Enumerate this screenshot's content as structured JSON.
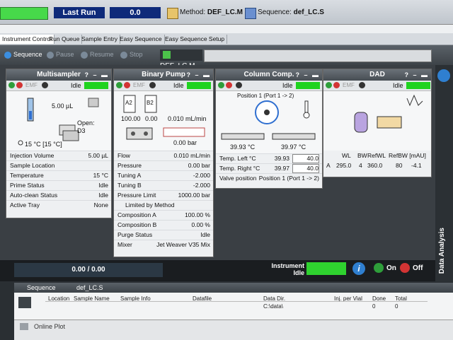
{
  "topbar": {
    "last_run_label": "Last Run",
    "run_value": "0.0",
    "method_label": "Method:",
    "method_name": "DEF_LC.M",
    "sequence_label": "Sequence:",
    "sequence_name": "def_LC.S"
  },
  "tabs": [
    {
      "label": "Instrument Control"
    },
    {
      "label": "Run Queue"
    },
    {
      "label": "Sample Entry"
    },
    {
      "label": "Easy Sequence"
    },
    {
      "label": "Easy Sequence Setup"
    }
  ],
  "toolbar": {
    "sequence": "Sequence",
    "pause": "Pause",
    "resume": "Resume",
    "stop": "Stop",
    "method_chip": "DEF_LC.M"
  },
  "modules": {
    "multisampler": {
      "title": "Multisampler",
      "status": "Idle",
      "volume": "5.00 µL",
      "open_label": "Open:",
      "open_pos": "D3",
      "temp": "15 °C [15 °C]",
      "params": [
        {
          "label": "Injection Volume",
          "value": "5.00 µL"
        },
        {
          "label": "Sample Location",
          "value": ""
        },
        {
          "label": "Temperature",
          "value": "15 °C"
        },
        {
          "label": "Prime Status",
          "value": "Idle"
        },
        {
          "label": "Auto-clean Status",
          "value": "Idle"
        },
        {
          "label": "Active Tray",
          "value": "None"
        }
      ]
    },
    "binary_pump": {
      "title": "Binary Pump",
      "status": "Idle",
      "bottle_a": "A2",
      "bottle_b": "B2",
      "val_a": "100.00",
      "val_b": "0.00",
      "flow_disp": "0.010 mL/min",
      "pressure_disp": "0.00 bar",
      "params": [
        {
          "label": "Flow",
          "value": "0.010 mL/min"
        },
        {
          "label": "Pressure",
          "value": "0.00 bar"
        },
        {
          "label": "Tuning A",
          "value": "-2.000"
        },
        {
          "label": "Tuning B",
          "value": "-2.000"
        },
        {
          "label": "Pressure Limit",
          "value": "1000.00 bar"
        },
        {
          "label": "Limited by Method",
          "value": ""
        },
        {
          "label": "Composition A",
          "value": "100.00 %"
        },
        {
          "label": "Composition B",
          "value": "0.00 %"
        },
        {
          "label": "Purge Status",
          "value": "Idle"
        },
        {
          "label": "Mixer",
          "value": "Jet Weaver V35 Mix"
        }
      ]
    },
    "column_comp": {
      "title": "Column Comp.",
      "status": "Idle",
      "position": "Position 1 (Port 1 -> 2)",
      "left_temp": "39.93 °C",
      "right_temp": "39.97 °C",
      "params": [
        {
          "label": "Temp. Left °C",
          "value": "39.93",
          "set": "40.0"
        },
        {
          "label": "Temp. Right °C",
          "value": "39.97",
          "set": "40.0"
        },
        {
          "label": "Valve position",
          "value": "Position 1 (Port 1 -> 2)",
          "set": ""
        }
      ]
    },
    "dad": {
      "title": "DAD",
      "status": "Idle",
      "table_headers": [
        "WL",
        "BW",
        "RefWL",
        "RefBW [mAU]"
      ],
      "row": {
        "ch": "A",
        "wl": "295.0",
        "bw": "4",
        "refwl": "360.0",
        "refbw": "80",
        "mau": "-4.1"
      }
    }
  },
  "side": {
    "label": "Data Analysis"
  },
  "bottom": {
    "progress": "0.00 / 0.00",
    "instrument_label": "Instrument",
    "instrument_status": "Idle",
    "on_label": "On",
    "off_label": "Off"
  },
  "sequence_panel": {
    "tab": "Sequence",
    "file": "def_LC.S",
    "headers": [
      "Location",
      "Sample Name",
      "Sample Info",
      "Datafile",
      "Data Dir.",
      "Inj. per Vial",
      "Done",
      "Total"
    ],
    "row": {
      "data_dir": "C:\\data\\",
      "done": "0",
      "total": "0"
    }
  },
  "online_plot": {
    "label": "Online Plot"
  },
  "colors": {
    "idle_green": "#1fd31f",
    "header_blue": "#0e2a7a",
    "on_green": "#2e9e3a",
    "off_red": "#d23434"
  }
}
